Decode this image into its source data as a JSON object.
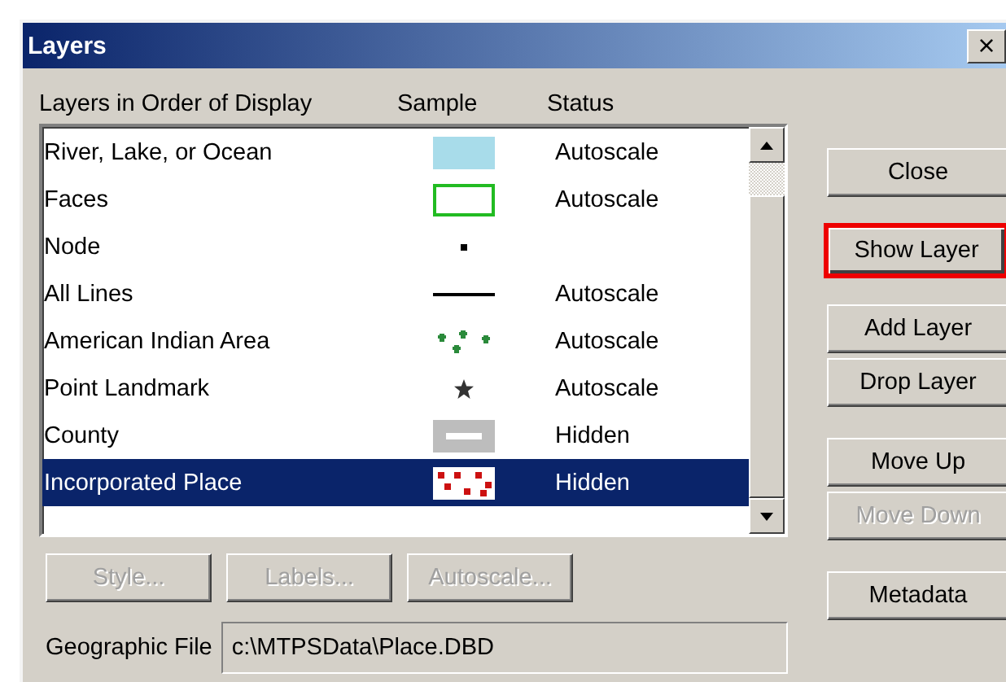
{
  "window": {
    "title": "Layers",
    "close": "×"
  },
  "columns": [
    "Layers in Order of Display",
    "Sample",
    "Status"
  ],
  "layers": [
    {
      "name": "River, Lake, or Ocean",
      "sample": {
        "kind": "fill",
        "color": "#a8dcea"
      },
      "status": "Autoscale",
      "selected": false
    },
    {
      "name": "Faces",
      "sample": {
        "kind": "outline",
        "color": "#22bb22"
      },
      "status": "Autoscale",
      "selected": false
    },
    {
      "name": "Node",
      "sample": {
        "kind": "dot",
        "color": "#000000"
      },
      "selected": false
    },
    {
      "name": "All Lines",
      "sample": {
        "kind": "line",
        "color": "#000000"
      },
      "status": "Autoscale",
      "selected": false
    },
    {
      "name": "American Indian Area",
      "sample": {
        "kind": "stars",
        "color": "#2a8a3a"
      },
      "status": "Autoscale",
      "selected": false
    },
    {
      "name": "Point Landmark",
      "sample": {
        "kind": "star",
        "color": "#333333"
      },
      "status": "Autoscale",
      "selected": false
    },
    {
      "name": "County",
      "sample": {
        "kind": "band",
        "color": "#bdbdbd"
      },
      "status": "Hidden",
      "selected": false
    },
    {
      "name": "Incorporated Place",
      "sample": {
        "kind": "dots",
        "color": "#cc1111"
      },
      "status": "Hidden",
      "selected": true
    }
  ],
  "list_buttons": [
    {
      "label": "Style...",
      "disabled": true
    },
    {
      "label": "Labels...",
      "disabled": true
    },
    {
      "label": "Autoscale...",
      "disabled": true
    }
  ],
  "side_buttons": [
    {
      "label": "Close",
      "disabled": false,
      "highlighted": false
    },
    {
      "label": "Show Layer",
      "disabled": false,
      "highlighted": true
    },
    {
      "label": "Add Layer",
      "disabled": false,
      "highlighted": false
    },
    {
      "label": "Drop Layer",
      "disabled": false,
      "highlighted": false
    },
    {
      "label": "Move Up",
      "disabled": false,
      "highlighted": false
    },
    {
      "label": "Move Down",
      "disabled": true,
      "highlighted": false
    },
    {
      "label": "Metadata",
      "disabled": false,
      "highlighted": false
    }
  ],
  "geographic_file": {
    "label": "Geographic File",
    "value": "c:\\MTPSData\\Place.DBD"
  }
}
